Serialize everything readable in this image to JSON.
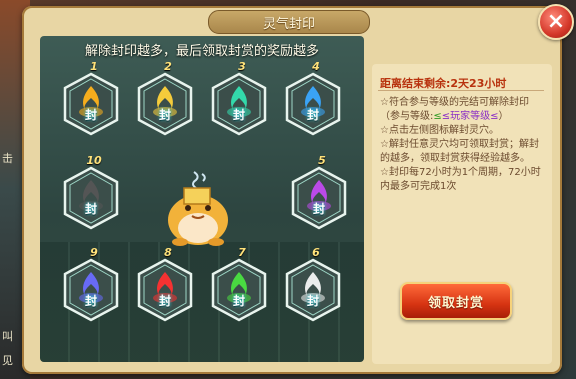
{
  "panel": {
    "title": "灵气封印",
    "close_icon": "close-icon",
    "banner": "解除封印越多，最后领取封赏的奖励越多"
  },
  "side": {
    "text_a": "击",
    "text_b": "叫",
    "text_c": "见"
  },
  "seals": [
    {
      "num": "1",
      "char": "封",
      "color": "#ffb21a"
    },
    {
      "num": "2",
      "char": "封",
      "color": "#ffd23a"
    },
    {
      "num": "3",
      "char": "封",
      "color": "#33e0b0"
    },
    {
      "num": "4",
      "char": "封",
      "color": "#3aa8ff"
    },
    {
      "num": "10",
      "char": "封",
      "color": "#555555"
    },
    {
      "num": "5",
      "char": "封",
      "color": "#c24af0"
    },
    {
      "num": "9",
      "char": "封",
      "color": "#6a6cff"
    },
    {
      "num": "8",
      "char": "封",
      "color": "#ff3030"
    },
    {
      "num": "7",
      "char": "封",
      "color": "#4ae040"
    },
    {
      "num": "6",
      "char": "封",
      "color": "#f4f4f4"
    }
  ],
  "info": {
    "countdown_label": "距离结束剩余:",
    "countdown_value": "2天23小时",
    "rule1": "☆符合参与等级的完结可解除封印",
    "rule2_prefix": "（参与等级:",
    "rule2_green": "≤",
    "rule2_purple": "≤玩家等级≤",
    "rule2_green2": "",
    "rule2_suffix": "）",
    "rule3": "☆点击左侧图标解封灵穴。",
    "rule4": "☆解封任意灵穴均可领取封赏；解封的越多，领取封赏获得经验越多。",
    "rule5": "☆封印每72小时为1个周期，72小时内最多可完成1次"
  },
  "claim_button": "领取封赏"
}
